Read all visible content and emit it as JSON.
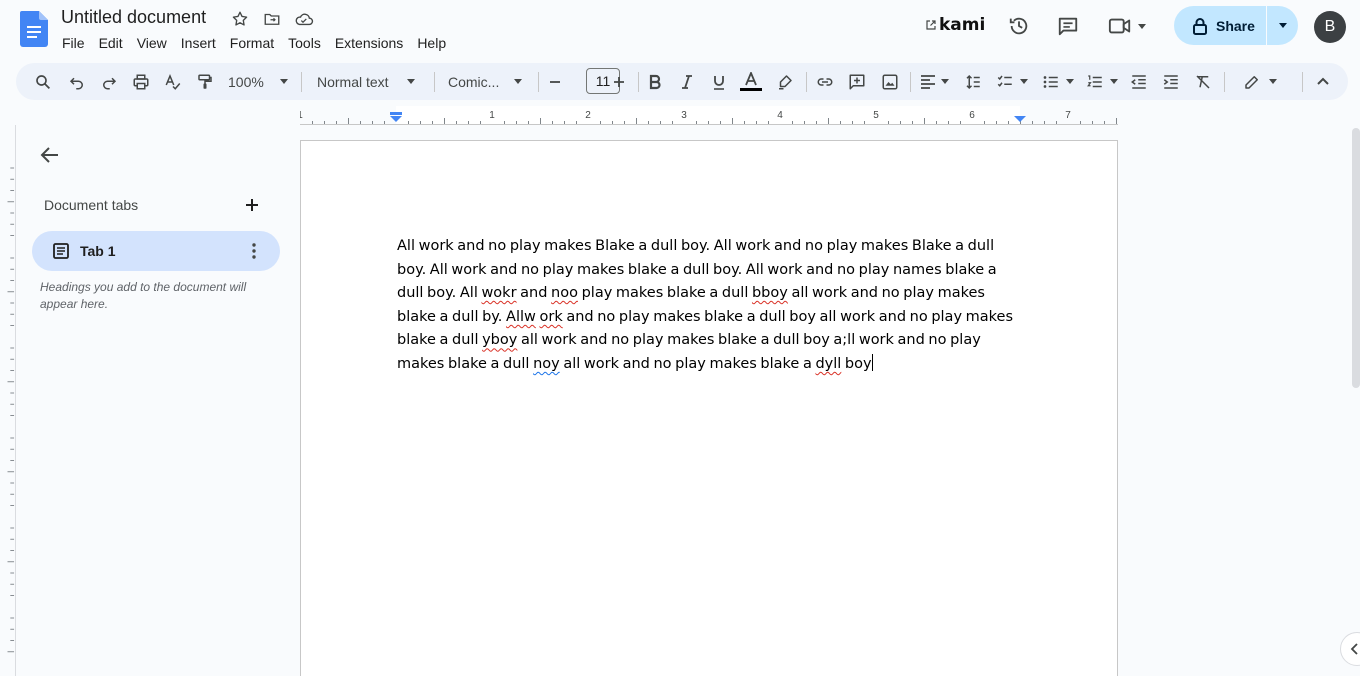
{
  "header": {
    "title": "Untitled document",
    "menu": [
      "File",
      "Edit",
      "View",
      "Insert",
      "Format",
      "Tools",
      "Extensions",
      "Help"
    ],
    "kami_label": "kami",
    "share_label": "Share",
    "avatar_letter": "B"
  },
  "toolbar": {
    "zoom": "100%",
    "style": "Normal text",
    "font": "Comic...",
    "font_size": "11"
  },
  "ruler": {
    "labels": [
      "1",
      "1",
      "2",
      "3",
      "4",
      "5",
      "6",
      "7"
    ]
  },
  "sidebar": {
    "heading": "Document tabs",
    "tab_label": "Tab 1",
    "hint": "Headings you add to the document will appear here."
  },
  "document": {
    "segments": [
      {
        "t": "All work and no play makes Blake a dull boy. All work and no play makes Blake a dull boy. All work and no play makes blake a dull boy. All work and no play names blake a dull boy. All "
      },
      {
        "t": "wokr",
        "s": "sp"
      },
      {
        "t": " and "
      },
      {
        "t": "noo",
        "s": "sp"
      },
      {
        "t": " play makes blake a dull "
      },
      {
        "t": "bboy",
        "s": "sp"
      },
      {
        "t": " all work and no play makes blake a dull by. "
      },
      {
        "t": "Allw",
        "s": "sp"
      },
      {
        "t": " "
      },
      {
        "t": "ork",
        "s": "sp"
      },
      {
        "t": " and no play makes blake a dull boy all work and no play makes blake a dull "
      },
      {
        "t": "yboy",
        "s": "sp"
      },
      {
        "t": " all work and no play makes blake a dull boy a;ll work and no play makes blake a dull "
      },
      {
        "t": "noy",
        "s": "gr"
      },
      {
        "t": " all work and no play makes blake a "
      },
      {
        "t": "dyll",
        "s": "sp"
      },
      {
        "t": " boy"
      }
    ]
  },
  "colors": {
    "share_bg": "#c2e7ff",
    "tab_active_bg": "#d3e3fd",
    "toolbar_bg": "#edf2fa",
    "spell_error": "#d93025",
    "grammar_error": "#1a73e8"
  }
}
